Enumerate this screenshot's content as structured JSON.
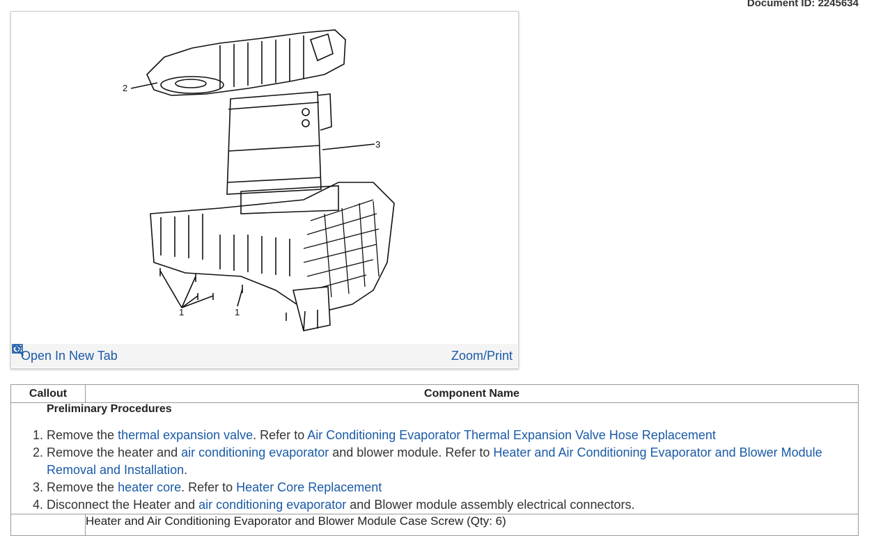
{
  "document": {
    "id_label": "Document ID: 2245634"
  },
  "figure": {
    "callout_labels": [
      "2",
      "3",
      "1",
      "1"
    ],
    "open_tab_label": "Open In New Tab",
    "zoom_label": "Zoom/Print"
  },
  "table": {
    "headers": [
      "Callout",
      "Component Name"
    ],
    "preliminary_title": "Preliminary Procedures",
    "steps": [
      [
        {
          "t": "Remove the "
        },
        {
          "t": "thermal expansion valve",
          "link": true
        },
        {
          "t": ". Refer to "
        },
        {
          "t": "Air Conditioning Evaporator Thermal Expansion Valve Hose Replacement",
          "link": true
        }
      ],
      [
        {
          "t": "Remove the heater and "
        },
        {
          "t": "air conditioning evaporator",
          "link": true
        },
        {
          "t": " and blower module. Refer to "
        },
        {
          "t": "Heater and Air Conditioning Evaporator and Blower Module Removal and Installation",
          "link": true
        },
        {
          "t": "."
        }
      ],
      [
        {
          "t": "Remove the "
        },
        {
          "t": "heater core",
          "link": true
        },
        {
          "t": ". Refer to "
        },
        {
          "t": "Heater Core Replacement",
          "link": true
        }
      ],
      [
        {
          "t": "Disconnect the Heater and "
        },
        {
          "t": "air conditioning evaporator",
          "link": true
        },
        {
          "t": " and Blower module assembly electrical connectors."
        }
      ]
    ],
    "next_row_text": "Heater and Air Conditioning Evaporator and Blower Module Case Screw (Qty: 6)"
  },
  "colors": {
    "link": "#1a5aa6",
    "border": "#999999"
  }
}
